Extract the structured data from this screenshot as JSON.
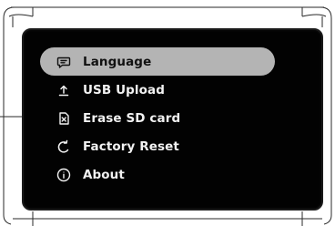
{
  "menu": {
    "items": [
      {
        "label": "Language",
        "icon": "chat-bubble-icon",
        "selected": true
      },
      {
        "label": "USB Upload",
        "icon": "upload-icon",
        "selected": false
      },
      {
        "label": "Erase SD card",
        "icon": "sd-card-erase-icon",
        "selected": false
      },
      {
        "label": "Factory Reset",
        "icon": "reset-icon",
        "selected": false
      },
      {
        "label": "About",
        "icon": "info-icon",
        "selected": false
      }
    ]
  },
  "colors": {
    "screen_bg": "#020202",
    "selected_bg": "#b4b4b4",
    "text": "#f2f2f2",
    "selected_text": "#111111"
  }
}
